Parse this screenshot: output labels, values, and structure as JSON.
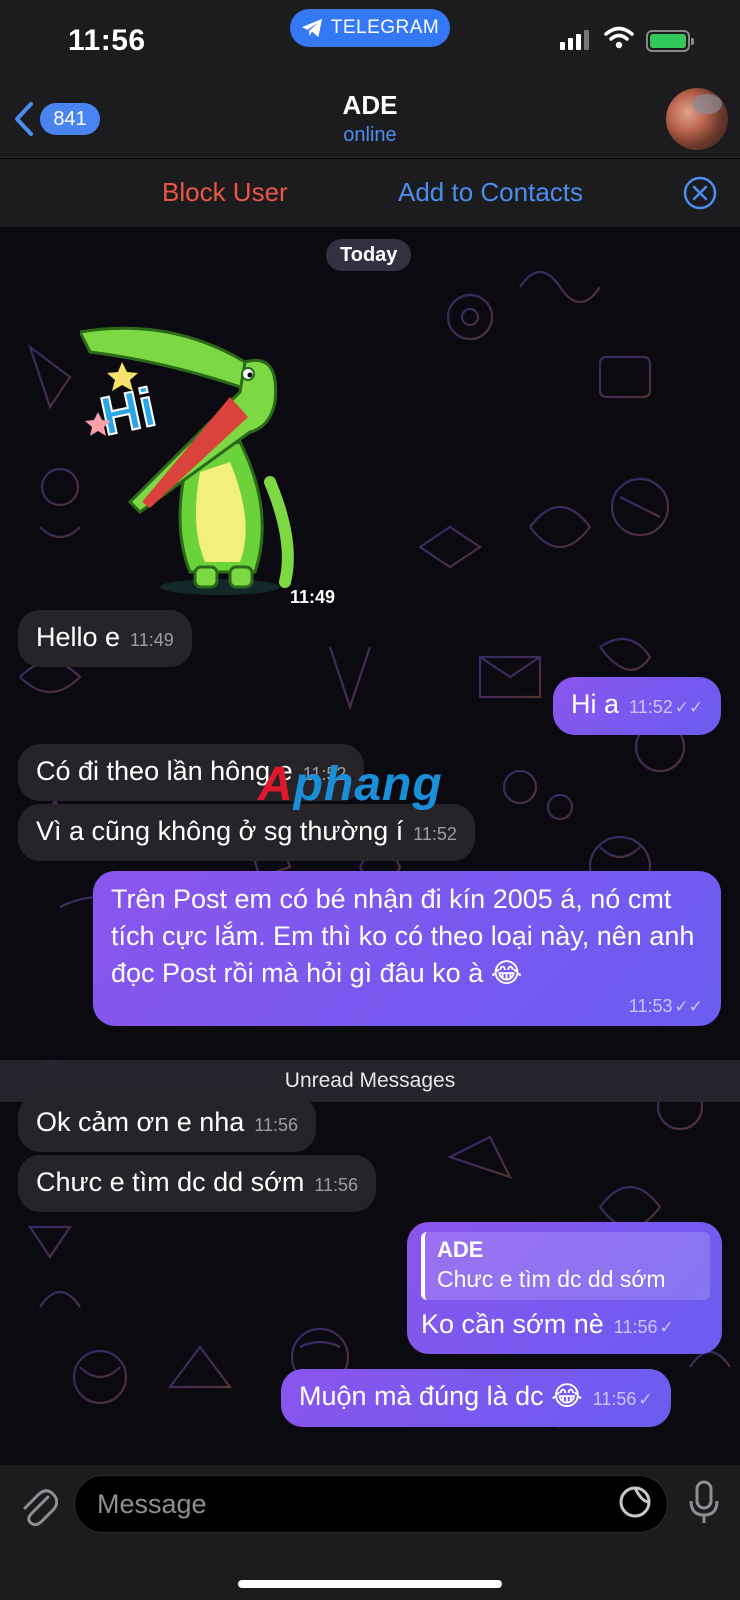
{
  "status_bar": {
    "time": "11:56",
    "app_pill": "TELEGRAM"
  },
  "header": {
    "back_count": "841",
    "title": "ADE",
    "status": "online"
  },
  "action_bar": {
    "block_label": "Block User",
    "add_label": "Add to Contacts"
  },
  "chat": {
    "date_label": "Today",
    "sticker_time": "11:49",
    "unread_label": "Unread Messages",
    "messages": [
      {
        "dir": "in",
        "text": "Hello e",
        "time": "11:49"
      },
      {
        "dir": "out",
        "text": "Hi a",
        "time": "11:52",
        "status": "✓✓"
      },
      {
        "dir": "in",
        "text": "Có đi theo lần hông e",
        "time": "11:52"
      },
      {
        "dir": "in",
        "text": "Vì a cũng không ở sg thường í",
        "time": "11:52"
      },
      {
        "dir": "out",
        "text": "Trên Post em có bé nhận đi kín 2005 á, nó cmt tích cực lắm. Em thì ko có theo loại này, nên anh đọc Post rồi mà hỏi gì đâu ko à 😂",
        "time": "11:53",
        "status": "✓✓"
      },
      {
        "dir": "in",
        "text": "Ok cảm ơn e nha",
        "time": "11:56"
      },
      {
        "dir": "in",
        "text": "Chưc e tìm dc dd sớm",
        "time": "11:56"
      },
      {
        "dir": "out",
        "reply_name": "ADE",
        "reply_text": "Chưc e tìm dc dd sớm",
        "text": "Ko cần sớm nè",
        "time": "11:56",
        "status": "✓"
      },
      {
        "dir": "out",
        "text": "Muộn mà đúng là dc 😂",
        "time": "11:56",
        "status": "✓"
      }
    ]
  },
  "watermark": {
    "part1": "A",
    "part2": "phang"
  },
  "input_bar": {
    "placeholder": "Message"
  },
  "colors": {
    "accent": "#4a8ef0",
    "danger": "#eb5545",
    "outgoing": "#7b58ef",
    "incoming": "#262429"
  }
}
